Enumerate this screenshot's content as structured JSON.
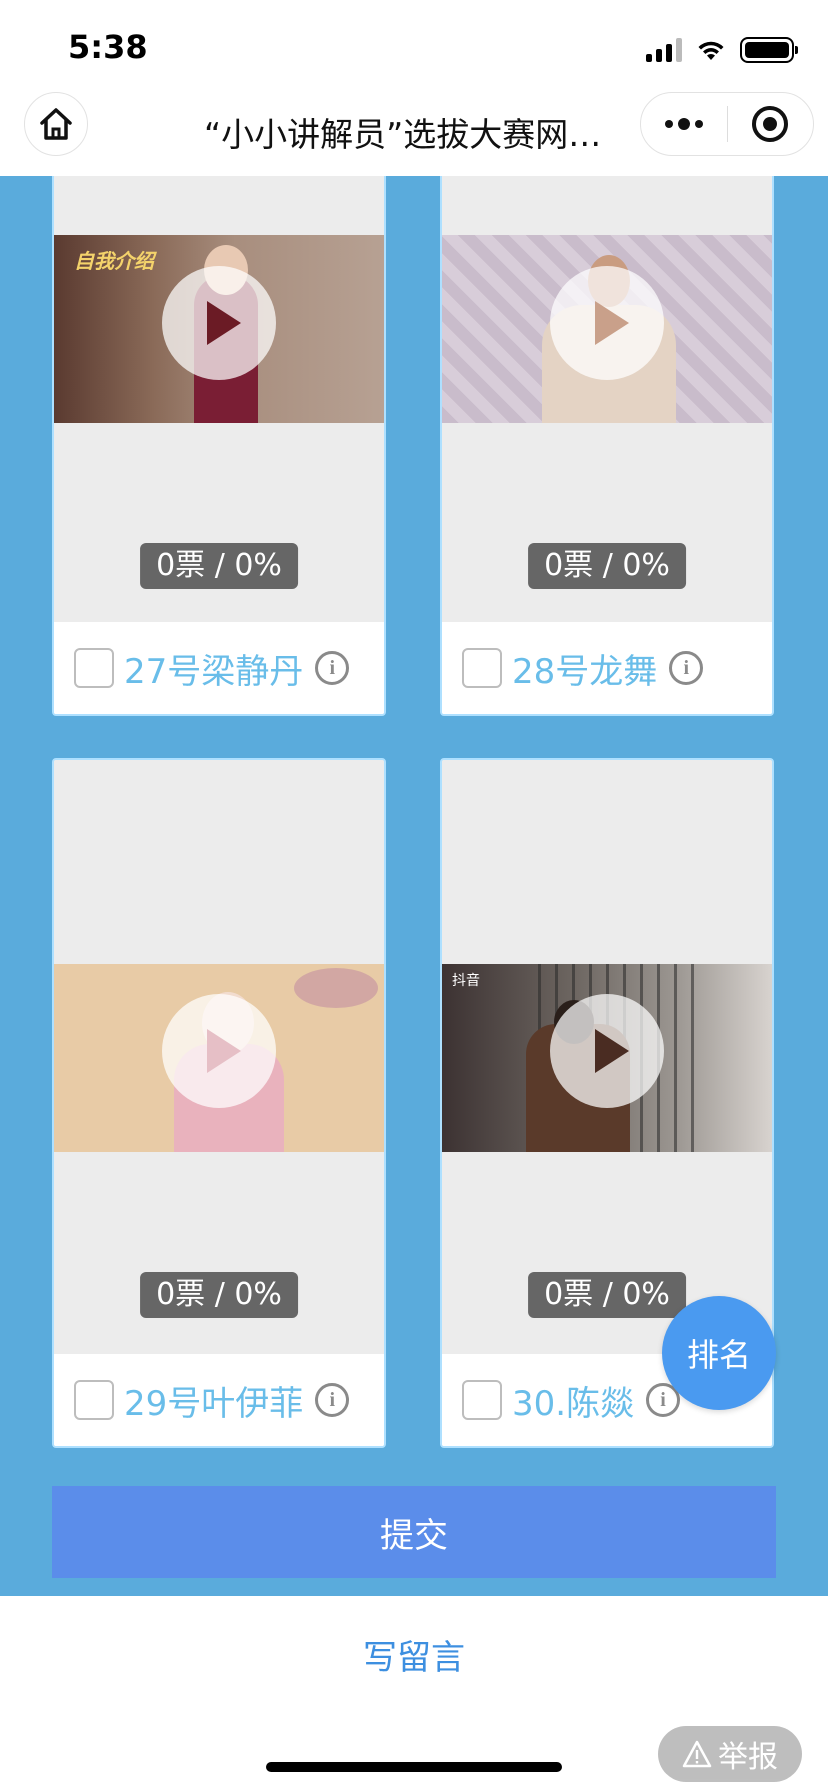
{
  "status_bar": {
    "time": "5:38"
  },
  "nav": {
    "title": "“小小讲解员”选拔大赛网…"
  },
  "cards": [
    {
      "name": "27号梁静丹",
      "votes": "0票 / 0%",
      "thumb_caption": "自我介绍"
    },
    {
      "name": "28号龙舞",
      "votes": "0票 / 0%"
    },
    {
      "name": "29号叶伊菲",
      "votes": "0票 / 0%"
    },
    {
      "name": "30.陈燚",
      "votes": "0票 / 0%",
      "thumb_caption": "抖音"
    }
  ],
  "submit_label": "提交",
  "rank_label": "排名",
  "comment_label": "写留言",
  "report_label": "举报",
  "colors": {
    "background_blue": "#5aabdc",
    "submit_button": "#5b8dea",
    "rank_button": "#4a9af0",
    "name_text": "#69bde9"
  }
}
